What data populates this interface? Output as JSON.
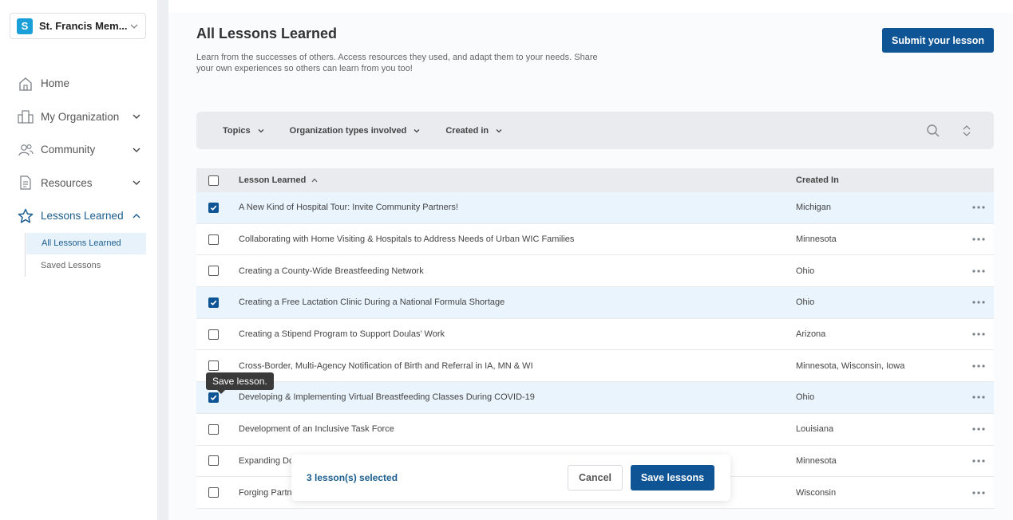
{
  "colors": {
    "accent": "#0f5596",
    "brand_badge": "#1a9fd8",
    "selected_row": "#eaf4fd"
  },
  "sidebar": {
    "org": {
      "badge": "S",
      "name": "St. Francis Mem..."
    },
    "items": [
      {
        "label": "Home",
        "icon": "home-icon"
      },
      {
        "label": "My Organization",
        "icon": "building-icon"
      },
      {
        "label": "Community",
        "icon": "people-icon"
      },
      {
        "label": "Resources",
        "icon": "document-icon"
      },
      {
        "label": "Lessons Learned",
        "icon": "star-icon"
      }
    ],
    "subitems": [
      {
        "label": "All Lessons Learned"
      },
      {
        "label": "Saved Lessons"
      }
    ]
  },
  "header": {
    "title": "All Lessons Learned",
    "description": "Learn from the successes of others. Access resources they used, and adapt them to your needs. Share your own experiences so others can learn from you too!",
    "submit_label": "Submit your lesson"
  },
  "filters": [
    {
      "label": "Topics"
    },
    {
      "label": "Organization types involved"
    },
    {
      "label": "Created in"
    }
  ],
  "table": {
    "columns": {
      "lesson": "Lesson Learned",
      "created": "Created In"
    },
    "rows": [
      {
        "lesson": "A New Kind of Hospital Tour: Invite Community Partners!",
        "created": "Michigan",
        "checked": true
      },
      {
        "lesson": "Collaborating with Home Visiting & Hospitals to Address Needs of Urban WIC Families",
        "created": "Minnesota",
        "checked": false
      },
      {
        "lesson": "Creating a County-Wide Breastfeeding Network",
        "created": "Ohio",
        "checked": false
      },
      {
        "lesson": "Creating a Free Lactation Clinic During a National Formula Shortage",
        "created": "Ohio",
        "checked": true
      },
      {
        "lesson": "Creating a Stipend Program to Support Doulas’ Work",
        "created": "Arizona",
        "checked": false
      },
      {
        "lesson": "Cross-Border, Multi-Agency Notification of Birth and Referral in IA, MN & WI",
        "created": "Minnesota, Wisconsin, Iowa",
        "checked": false
      },
      {
        "lesson": "Developing & Implementing Virtual Breastfeeding Classes During COVID-19",
        "created": "Ohio",
        "checked": true
      },
      {
        "lesson": "Development of an Inclusive Task Force",
        "created": "Louisiana",
        "checked": false
      },
      {
        "lesson": "Expanding Do",
        "created": "Minnesota",
        "checked": false
      },
      {
        "lesson": "Forging Partn",
        "created": "Wisconsin",
        "checked": false
      }
    ]
  },
  "tooltip": {
    "text": "Save lesson."
  },
  "selection": {
    "count_text": "3 lesson(s) selected",
    "cancel_label": "Cancel",
    "save_label": "Save lessons"
  }
}
